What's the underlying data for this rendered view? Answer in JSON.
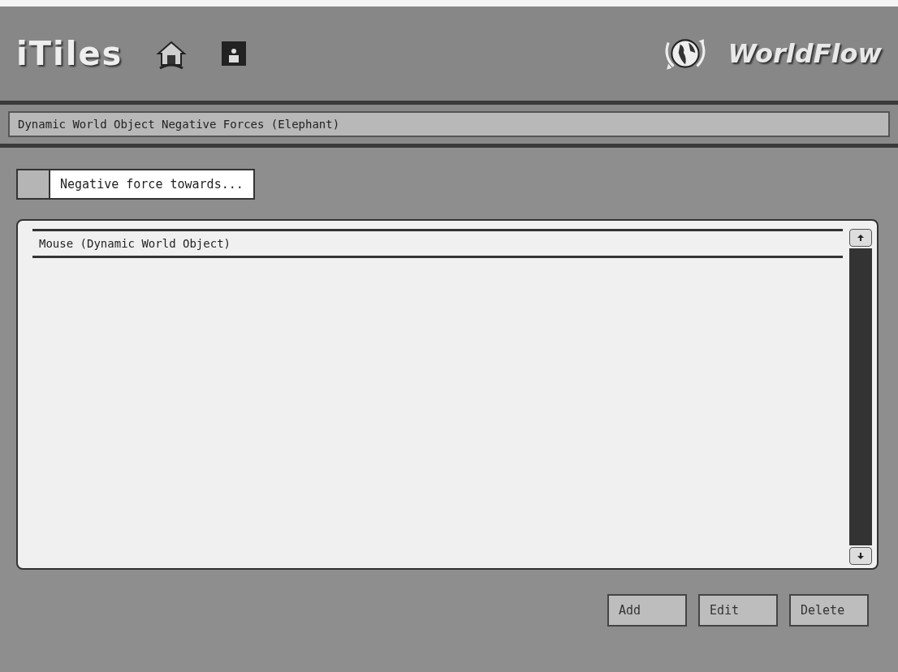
{
  "header": {
    "app_name": "iTiles",
    "brand": "WorldFlow"
  },
  "title_bar": {
    "text": "Dynamic World Object Negative Forces (Elephant)"
  },
  "section": {
    "label": "Negative force towards..."
  },
  "list": {
    "items": [
      {
        "label": "Mouse (Dynamic World Object)"
      }
    ]
  },
  "buttons": [
    {
      "label": "Add"
    },
    {
      "label": "Edit"
    },
    {
      "label": "Delete"
    }
  ]
}
